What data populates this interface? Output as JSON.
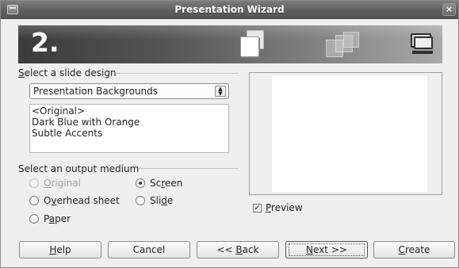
{
  "window": {
    "title": "Presentation Wizard",
    "close_glyph": "×"
  },
  "banner": {
    "step": "2."
  },
  "design": {
    "label": {
      "mnemonic": "S",
      "rest": "elect a slide design"
    },
    "category": "Presentation Backgrounds",
    "items": [
      "<Original>",
      "Dark Blue with Orange",
      "Subtle Accents"
    ]
  },
  "output": {
    "label": "Select an output medium",
    "options": {
      "original": {
        "pre": "",
        "mnemonic": "O",
        "post": "riginal",
        "checked": false,
        "enabled": false
      },
      "screen": {
        "pre": "Sc",
        "mnemonic": "r",
        "post": "een",
        "checked": true,
        "enabled": true
      },
      "overhead": {
        "pre": "O",
        "mnemonic": "v",
        "post": "erhead sheet",
        "checked": false,
        "enabled": true
      },
      "slide": {
        "pre": "Sli",
        "mnemonic": "d",
        "post": "e",
        "checked": false,
        "enabled": true
      },
      "paper": {
        "pre": "P",
        "mnemonic": "a",
        "post": "per",
        "checked": false,
        "enabled": true
      }
    }
  },
  "preview": {
    "pre": "",
    "mnemonic": "P",
    "post": "review",
    "checked": true,
    "check_glyph": "✓"
  },
  "buttons": {
    "help": {
      "pre": "",
      "mnemonic": "H",
      "post": "elp"
    },
    "cancel": {
      "pre": "Cancel",
      "mnemonic": "",
      "post": ""
    },
    "back": {
      "pre": "<< ",
      "mnemonic": "B",
      "post": "ack"
    },
    "next": {
      "pre": "",
      "mnemonic": "N",
      "post": "ext >>"
    },
    "create": {
      "pre": "",
      "mnemonic": "C",
      "post": "reate"
    }
  },
  "icons": {
    "app": "app-window-icon",
    "close": "close-icon",
    "slides": "slide-pages-icon",
    "stack": "slide-stack-icon",
    "monitor": "monitor-icon",
    "combo_arrows": "up-down-arrows-icon"
  },
  "colors": {
    "titlebar": "#5e5e5e",
    "banner_dark": "#3b3b3b",
    "banner_light": "#a9a9a9",
    "dialog_bg": "#efefef"
  }
}
